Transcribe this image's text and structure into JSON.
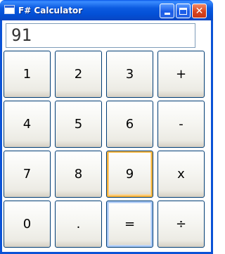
{
  "window": {
    "title": "F# Calculator"
  },
  "display": {
    "value": "91"
  },
  "keys": {
    "k1": "1",
    "k2": "2",
    "k3": "3",
    "plus": "+",
    "k4": "4",
    "k5": "5",
    "k6": "6",
    "minus": "-",
    "k7": "7",
    "k8": "8",
    "k9": "9",
    "multiply": "x",
    "k0": "0",
    "decimal": ".",
    "equals": "=",
    "divide": "÷"
  },
  "colors": {
    "title_bar": "#0a52d6",
    "hover_outline": "#f8b33a",
    "focus_outline": "#a6c6f4"
  },
  "icons": {
    "app": "window-icon",
    "minimize": "minimize-icon",
    "maximize": "maximize-icon",
    "close": "close-icon"
  }
}
